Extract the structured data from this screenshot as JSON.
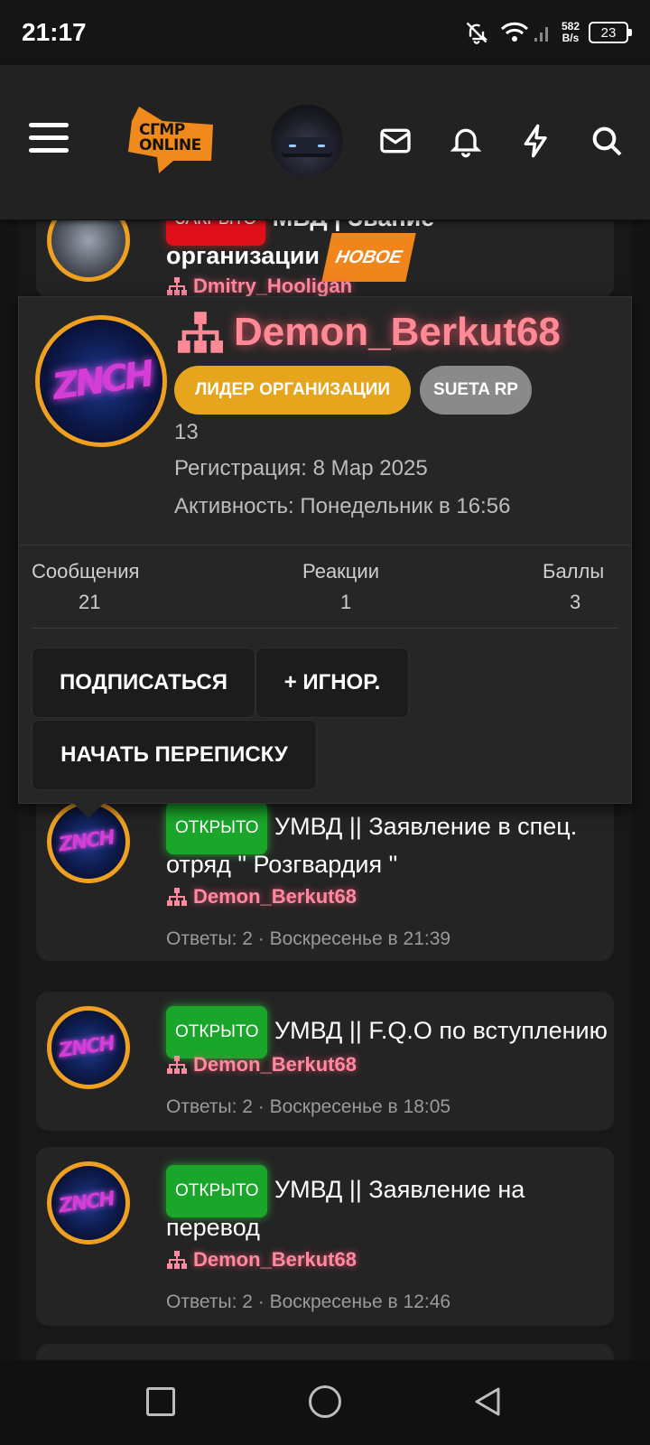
{
  "status_bar": {
    "time": "21:17",
    "net_speed_value": "582",
    "net_speed_unit": "B/s",
    "battery": "23"
  },
  "header": {
    "logo_text_line1": "СГМР",
    "logo_text_line2": "ONLINE",
    "icons": [
      "menu-icon",
      "mail-icon",
      "bell-icon",
      "bolt-icon",
      "search-icon"
    ]
  },
  "popup": {
    "username": "Demon_Berkut68",
    "role_badge": "ЛИДЕР ОРГАНИЗАЦИИ",
    "server_badge": "SUETA RP",
    "level": "13",
    "registration_label": "Регистрация:",
    "registration_value": "8 Мар 2025",
    "activity_label": "Активность:",
    "activity_value": "Понедельник в 16:56",
    "stats": [
      {
        "label": "Сообщения",
        "value": "21"
      },
      {
        "label": "Реакции",
        "value": "1"
      },
      {
        "label": "Баллы",
        "value": "3"
      }
    ],
    "subscribe_label": "ПОДПИСАТЬСЯ",
    "ignore_label": "+ ИГНОР.",
    "start_conversation_label": "НАЧАТЬ ПЕРЕПИСКУ"
  },
  "threads": [
    {
      "status": "ЗАКРЫТО",
      "title_line1": "МВД | Звание",
      "title_line2": "организации",
      "new_badge": "НОВОЕ",
      "author": "Dmitry_Hooligan"
    },
    {
      "status": "ОТКРЫТО",
      "title_line1": "УМВД || Заявление в спец.",
      "title_line2": "отряд \" Розгвардия \"",
      "author": "Demon_Berkut68",
      "meta": "Ответы: 2 · Воскресенье в 21:39"
    },
    {
      "status": "ОТКРЫТО",
      "title_line1": "УМВД || F.Q.O по вступлению",
      "author": "Demon_Berkut68",
      "meta": "Ответы: 2 · Воскресенье в 18:05"
    },
    {
      "status": "ОТКРЫТО",
      "title_line1": "УМВД || Заявление на",
      "title_line2": "перевод",
      "author": "Demon_Berkut68",
      "meta": "Ответы: 2 · Воскресенье в 12:46"
    }
  ],
  "colors": {
    "accent_orange": "#f0a020",
    "open_green": "#19a62a",
    "closed_red": "#e0101a",
    "username_pink": "#ff8a96",
    "leader_gold": "#e6a51c"
  }
}
